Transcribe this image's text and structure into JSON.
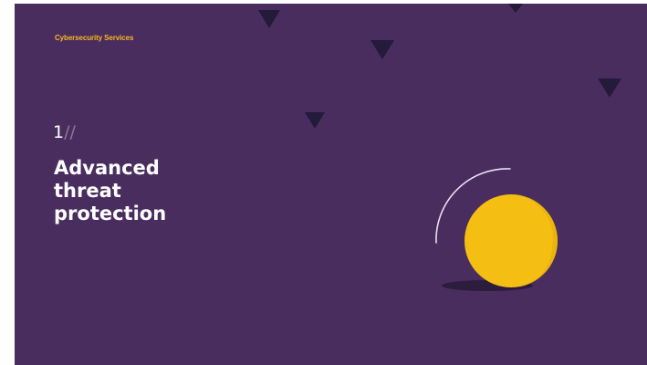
{
  "slide": {
    "eyebrow": "Cybersecurity Services",
    "number": "1",
    "number_suffix": "//",
    "title_lines": [
      "Advanced",
      "threat",
      "protection"
    ]
  },
  "colors": {
    "background": "#4a2d5f",
    "accent": "#f5b820",
    "ball": "#f4bf12",
    "triangles": "#241a3a",
    "text": "#ffffff"
  },
  "icons": [
    "triangle-icon",
    "ball-icon",
    "motion-arc-icon"
  ]
}
